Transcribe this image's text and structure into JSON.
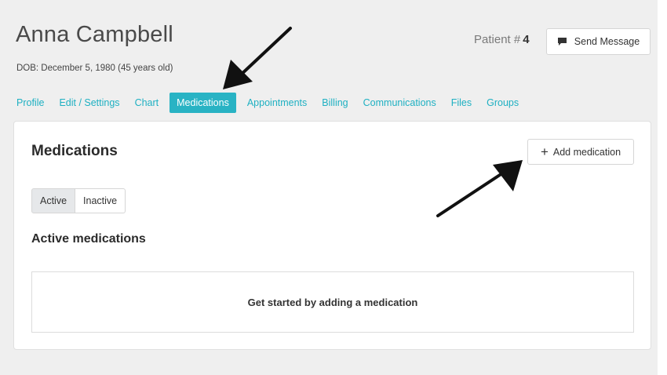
{
  "patient": {
    "name": "Anna Campbell",
    "dob": "DOB: December 5, 1980 (45 years old)",
    "number_label": "Patient #",
    "number": "4"
  },
  "header": {
    "send_message_label": "Send Message"
  },
  "tabs": [
    {
      "label": "Profile",
      "active": false
    },
    {
      "label": "Edit / Settings",
      "active": false
    },
    {
      "label": "Chart",
      "active": false
    },
    {
      "label": "Medications",
      "active": true
    },
    {
      "label": "Appointments",
      "active": false
    },
    {
      "label": "Billing",
      "active": false
    },
    {
      "label": "Communications",
      "active": false
    },
    {
      "label": "Files",
      "active": false
    },
    {
      "label": "Groups",
      "active": false
    }
  ],
  "medications": {
    "title": "Medications",
    "add_label": "Add medication",
    "filter": {
      "active_label": "Active",
      "inactive_label": "Inactive",
      "selected": "Active"
    },
    "section_title": "Active medications",
    "empty_text": "Get started by adding a medication"
  },
  "colors": {
    "accent": "#29b3c4",
    "tab_text": "#1eb0c2",
    "background": "#efefef",
    "card": "#ffffff"
  },
  "icons": {
    "send_message": "chat-bubble-icon",
    "add": "plus-icon",
    "annotation": "pointer-arrow-icon"
  }
}
